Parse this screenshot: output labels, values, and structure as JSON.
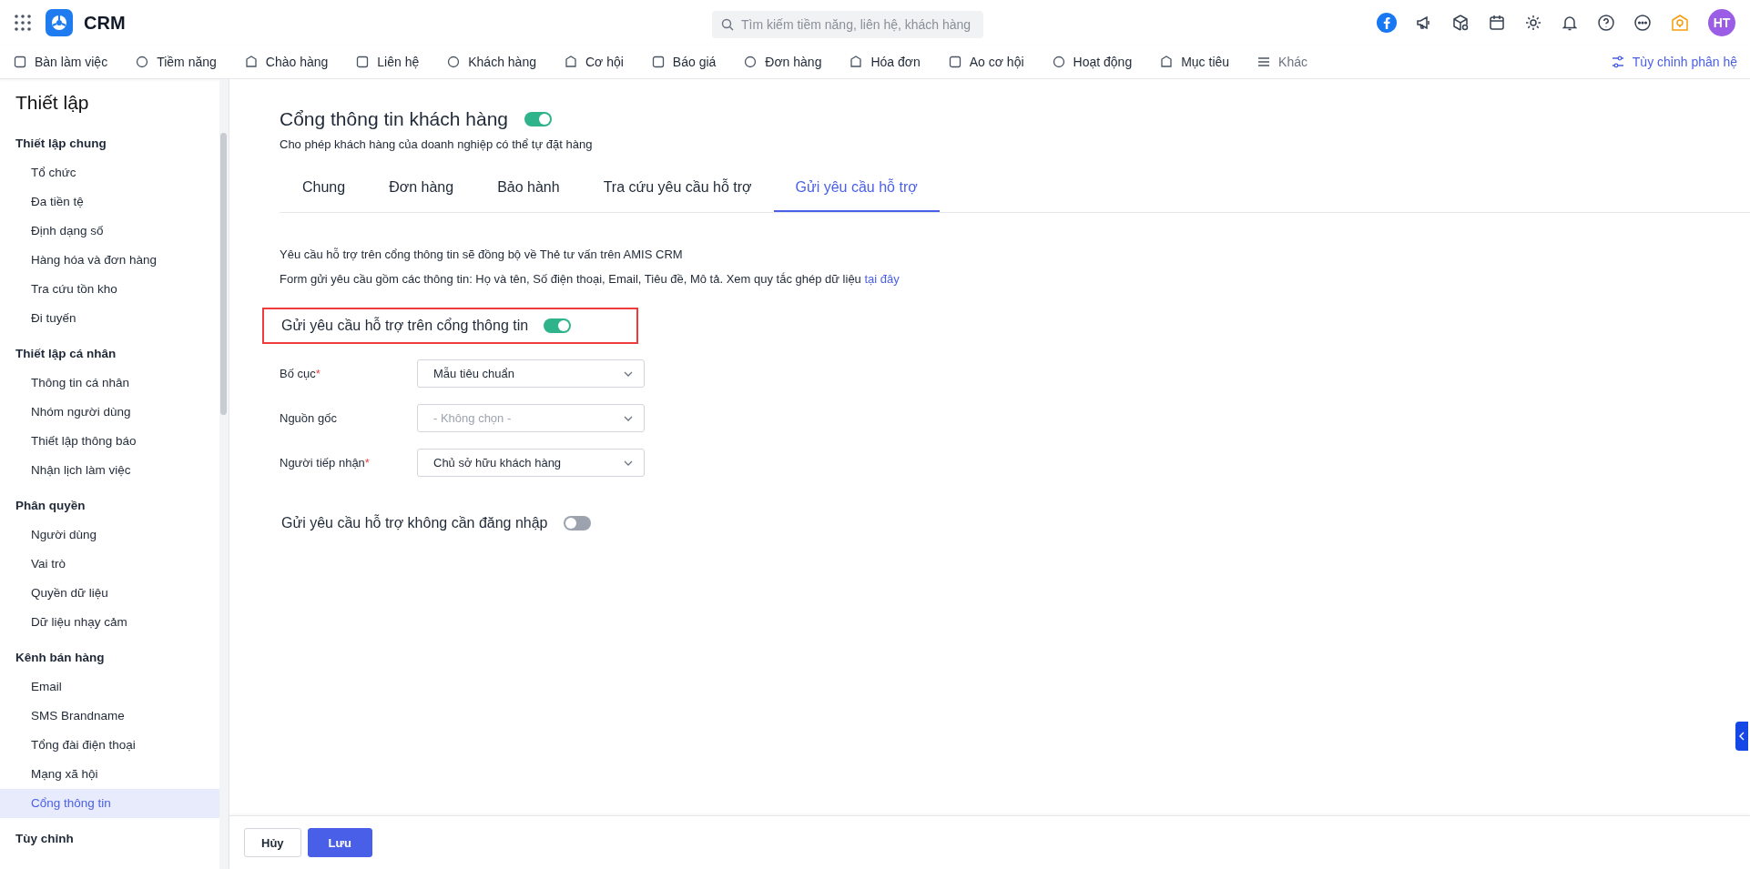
{
  "app": {
    "name": "CRM",
    "avatar": "HT"
  },
  "search": {
    "placeholder": "Tìm kiếm tiềm năng, liên hệ, khách hàng"
  },
  "nav": [
    {
      "label": "Bàn làm việc",
      "selected": false
    },
    {
      "label": "Tiềm năng",
      "selected": false
    },
    {
      "label": "Chào hàng",
      "selected": false
    },
    {
      "label": "Liên hệ",
      "selected": false
    },
    {
      "label": "Khách hàng",
      "selected": false
    },
    {
      "label": "Cơ hội",
      "selected": false
    },
    {
      "label": "Báo giá",
      "selected": false
    },
    {
      "label": "Đơn hàng",
      "selected": false
    },
    {
      "label": "Hóa đơn",
      "selected": false
    },
    {
      "label": "Ao cơ hội",
      "selected": false
    },
    {
      "label": "Hoạt động",
      "selected": false
    },
    {
      "label": "Mục tiêu",
      "selected": false
    },
    {
      "label": "Khác",
      "selected": false
    }
  ],
  "customize": "Tùy chỉnh phân hệ",
  "sidebar": {
    "title": "Thiết lập",
    "groups": [
      {
        "label": "Thiết lập chung",
        "items": [
          {
            "label": "Tổ chức",
            "selected": false
          },
          {
            "label": "Đa tiền tệ",
            "selected": false
          },
          {
            "label": "Định dạng số",
            "selected": false
          },
          {
            "label": "Hàng hóa và đơn hàng",
            "selected": false
          },
          {
            "label": "Tra cứu tồn kho",
            "selected": false
          },
          {
            "label": "Đi tuyến",
            "selected": false
          }
        ]
      },
      {
        "label": "Thiết lập cá nhân",
        "items": [
          {
            "label": "Thông tin cá nhân",
            "selected": false
          },
          {
            "label": "Nhóm người dùng",
            "selected": false
          },
          {
            "label": "Thiết lập thông báo",
            "selected": false
          },
          {
            "label": "Nhận lịch làm việc",
            "selected": false
          }
        ]
      },
      {
        "label": "Phân quyền",
        "items": [
          {
            "label": "Người dùng",
            "selected": false
          },
          {
            "label": "Vai trò",
            "selected": false
          },
          {
            "label": "Quyền dữ liệu",
            "selected": false
          },
          {
            "label": "Dữ liệu nhạy cảm",
            "selected": false
          }
        ]
      },
      {
        "label": "Kênh bán hàng",
        "items": [
          {
            "label": "Email",
            "selected": false
          },
          {
            "label": "SMS Brandname",
            "selected": false
          },
          {
            "label": "Tổng đài điện thoại",
            "selected": false
          },
          {
            "label": "Mạng xã hội",
            "selected": false
          },
          {
            "label": "Cổng thông tin",
            "selected": true
          }
        ]
      },
      {
        "label": "Tùy chỉnh"
      }
    ]
  },
  "page": {
    "title": "Cổng thông tin khách hàng",
    "enabled": true,
    "subtitle": "Cho phép khách hàng của doanh nghiệp có thể tự đặt hàng"
  },
  "tabs": [
    {
      "label": "Chung",
      "selected": false
    },
    {
      "label": "Đơn hàng",
      "selected": false
    },
    {
      "label": "Bảo hành",
      "selected": false
    },
    {
      "label": "Tra cứu yêu cầu hỗ trợ",
      "selected": false
    },
    {
      "label": "Gửi yêu cầu hỗ trợ",
      "selected": true
    }
  ],
  "info": [
    "Yêu cầu hỗ trợ trên cổng thông tin sẽ đồng bộ về Thẻ tư vấn trên AMIS CRM",
    "Form gửi yêu cầu gồm các thông tin: Họ và tên, Số điện thoại, Email, Tiêu đề, Mô tả. Xem quy tắc ghép dữ liệu"
  ],
  "info_link": "tại đây",
  "portal_toggle": {
    "label": "Gửi yêu cầu hỗ trợ trên cổng thông tin",
    "on": true,
    "highlighted": true
  },
  "fields": [
    {
      "label": "Bố cục",
      "required": true,
      "value": "Mẫu tiêu chuẩn"
    },
    {
      "label": "Nguồn gốc",
      "required": false,
      "placeholder": "- Không chọn -"
    },
    {
      "label": "Người tiếp nhận",
      "required": true,
      "value": "Chủ sở hữu khách hàng"
    }
  ],
  "required_mark": "*",
  "guest_toggle": {
    "label": "Gửi yêu cầu hỗ trợ không cần đăng nhập",
    "on": false
  },
  "buttons": [
    {
      "label": "Hủy",
      "kind": "secondary"
    },
    {
      "label": "Lưu",
      "kind": "primary"
    }
  ]
}
